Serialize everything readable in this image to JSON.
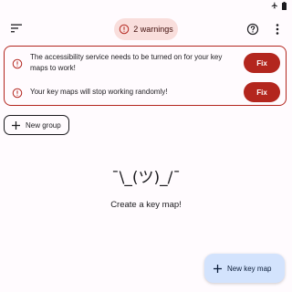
{
  "status_bar": {
    "icons": [
      "airplane-icon",
      "battery-icon"
    ]
  },
  "top_bar": {
    "menu_icon": "sort-icon",
    "warnings_chip_label": "2 warnings",
    "help_icon": "help-circle-icon",
    "more_icon": "more-vert-icon"
  },
  "warnings": [
    {
      "text": "The accessibility service needs to be turned on for your key maps to work!",
      "button_label": "Fix"
    },
    {
      "text": "Your key maps will stop working randomly!",
      "button_label": "Fix"
    }
  ],
  "new_group_button": {
    "label": "New group"
  },
  "empty_state": {
    "face": "¯\\_(ツ)_/¯",
    "message": "Create a key map!"
  },
  "fab": {
    "label": "New key map"
  },
  "colors": {
    "error": "#B3261E",
    "error_container": "#F9DEDC",
    "fab_background": "#D3E3FD",
    "background": "#FFFBFE"
  }
}
